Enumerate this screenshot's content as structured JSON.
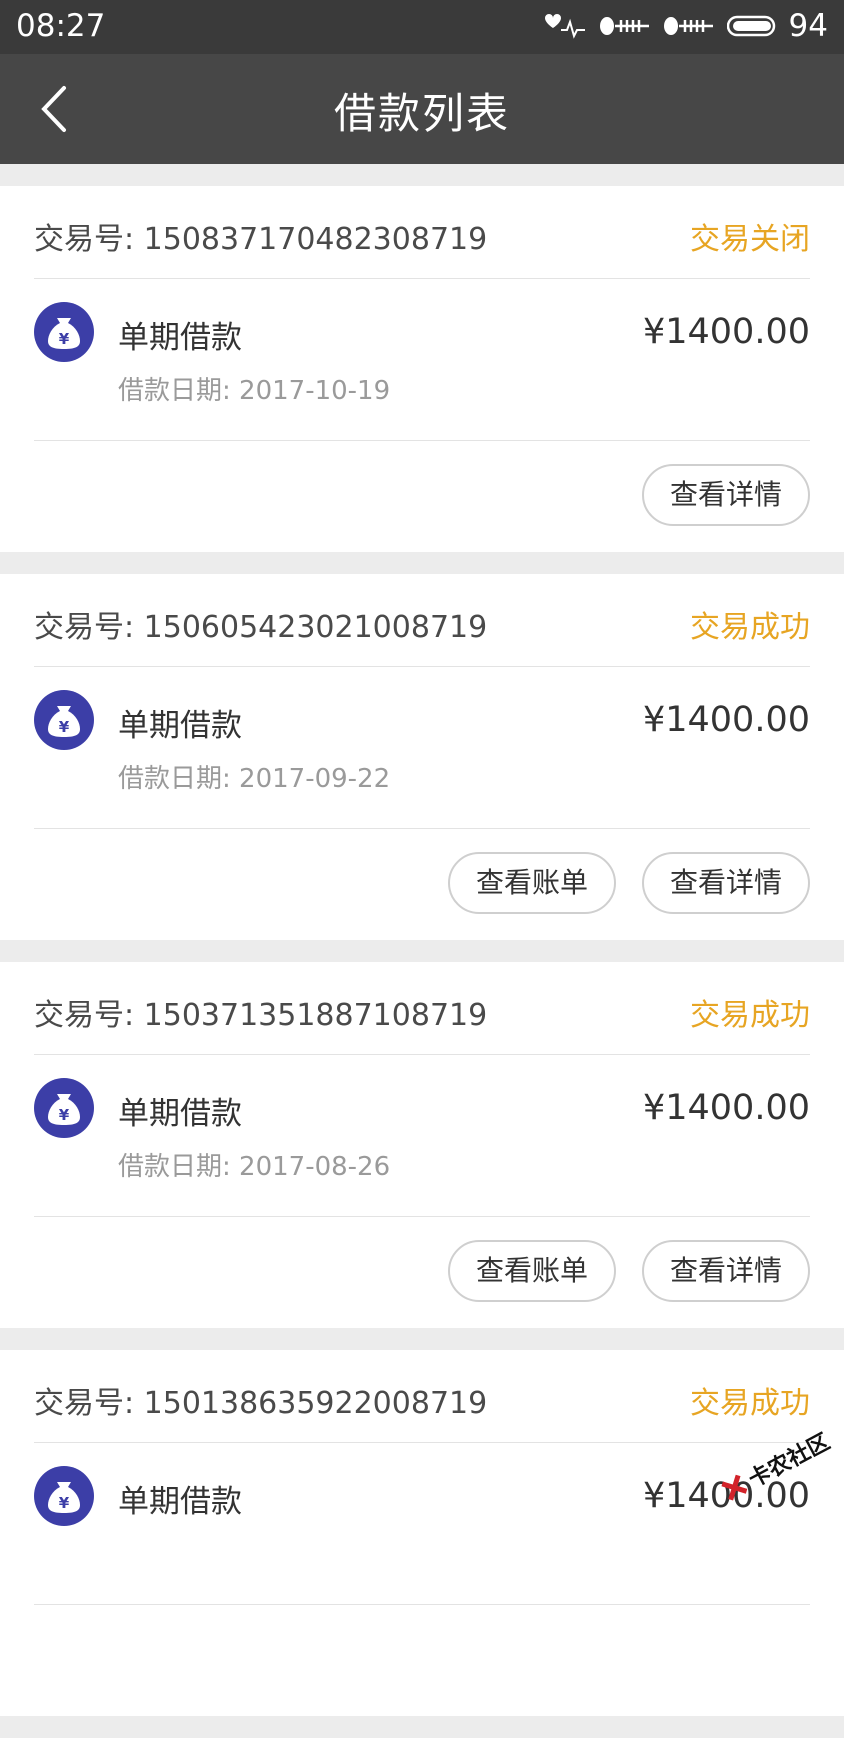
{
  "status_bar": {
    "time": "08:27",
    "battery": "94",
    "icons": [
      "heart-wifi-icon",
      "signal-icon",
      "signal-icon",
      "battery-icon"
    ]
  },
  "nav": {
    "title": "借款列表",
    "back_icon": "chevron-left-icon"
  },
  "colors": {
    "status_accent": "#e7a523",
    "icon_bg": "#3c3ea7",
    "nav_bg": "#474747"
  },
  "cards": [
    {
      "txn": "交易号: 1508371704823087​19",
      "status": "交易关闭",
      "type": "单期借款",
      "date": "借款日期: 2017-10-19",
      "amount": "¥1400.00",
      "bill_label": "",
      "detail_label": "查看详情"
    },
    {
      "txn": "交易号: 1506054230210087​19",
      "status": "交易成功",
      "type": "单期借款",
      "date": "借款日期: 2017-09-22",
      "amount": "¥1400.00",
      "bill_label": "查看账单",
      "detail_label": "查看详情"
    },
    {
      "txn": "交易号: 1503713518871087​19",
      "status": "交易成功",
      "type": "单期借款",
      "date": "借款日期: 2017-08-26",
      "amount": "¥1400.00",
      "bill_label": "查看账单",
      "detail_label": "查看详情"
    },
    {
      "txn": "交易号: 1501386359220087​19",
      "status": "交易成功",
      "type": "单期借款",
      "date": "",
      "amount": "¥1400.00",
      "bill_label": "",
      "detail_label": ""
    }
  ],
  "watermark": {
    "text": "卡农社区"
  }
}
